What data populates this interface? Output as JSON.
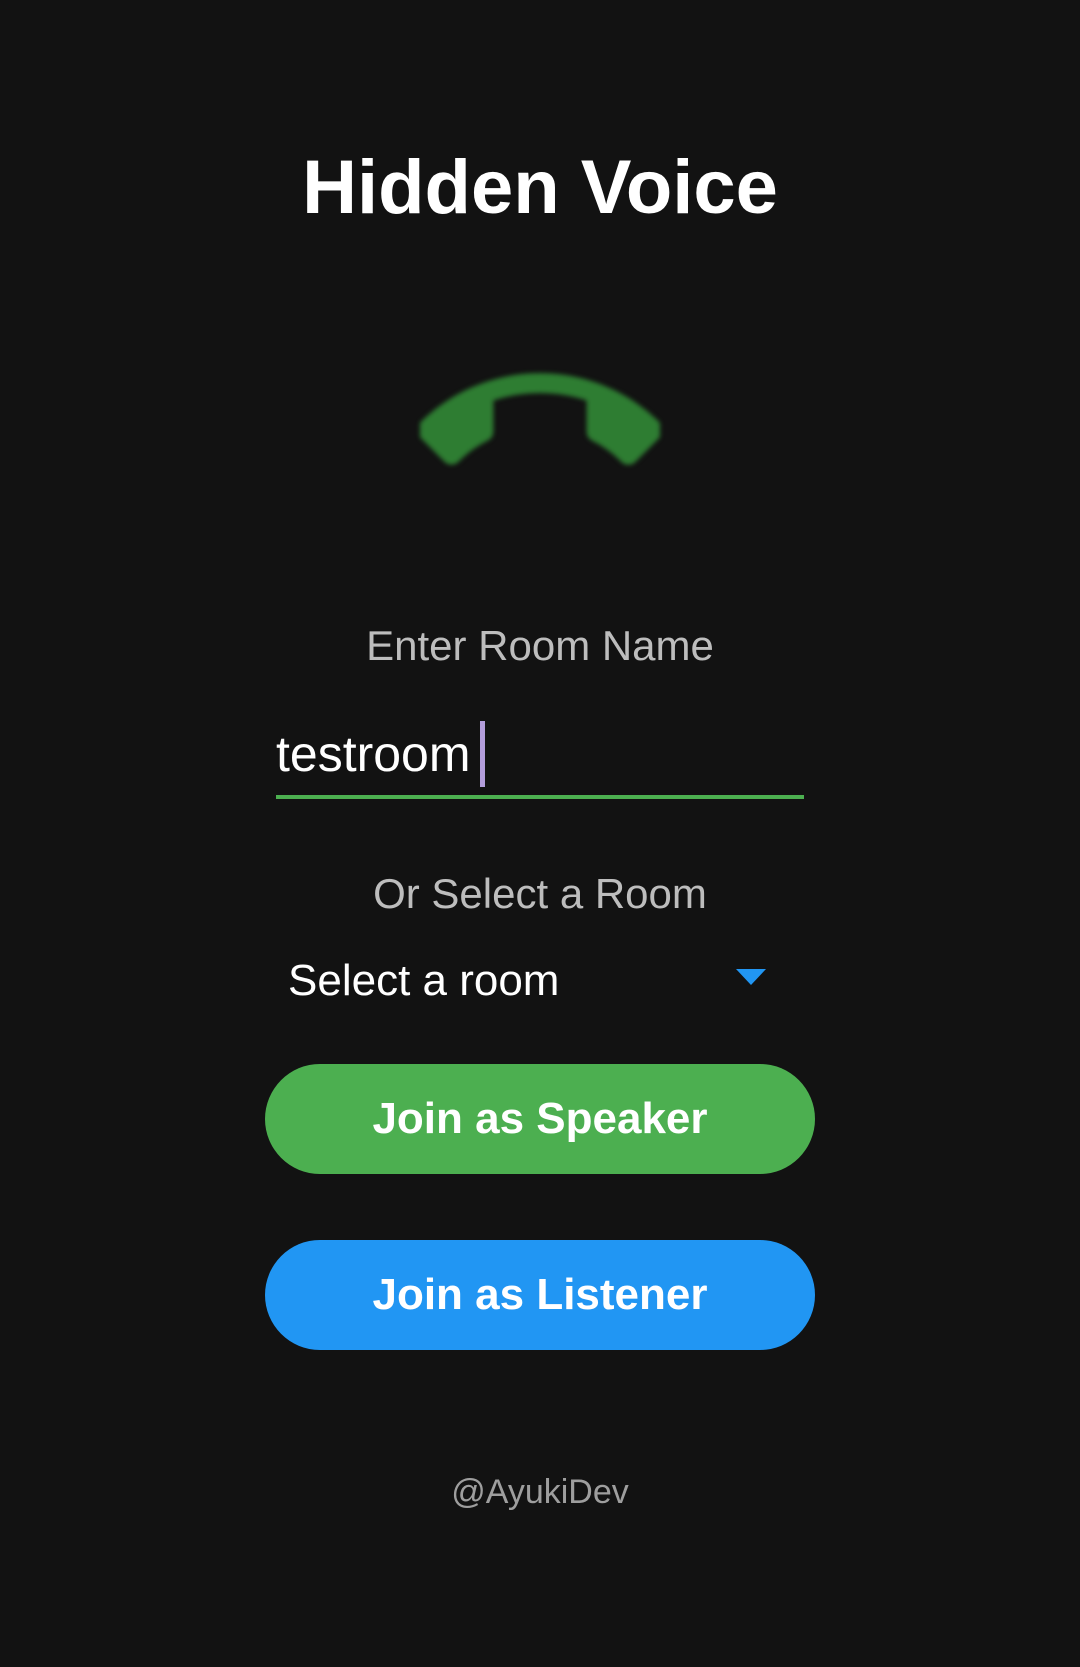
{
  "app": {
    "title": "Hidden Voice"
  },
  "icon": {
    "name": "phone-icon",
    "color": "#2e7d32"
  },
  "room_input": {
    "label": "Enter Room Name",
    "value": "testroom",
    "underline_color": "#4caf50"
  },
  "room_select": {
    "label": "Or Select a Room",
    "selected": "Select a room",
    "arrow_color": "#2196f3"
  },
  "buttons": {
    "speaker_label": "Join as Speaker",
    "speaker_color": "#4caf50",
    "listener_label": "Join as Listener",
    "listener_color": "#2196f3"
  },
  "footer": {
    "credit": "@AyukiDev"
  },
  "theme": {
    "background": "#121212"
  }
}
